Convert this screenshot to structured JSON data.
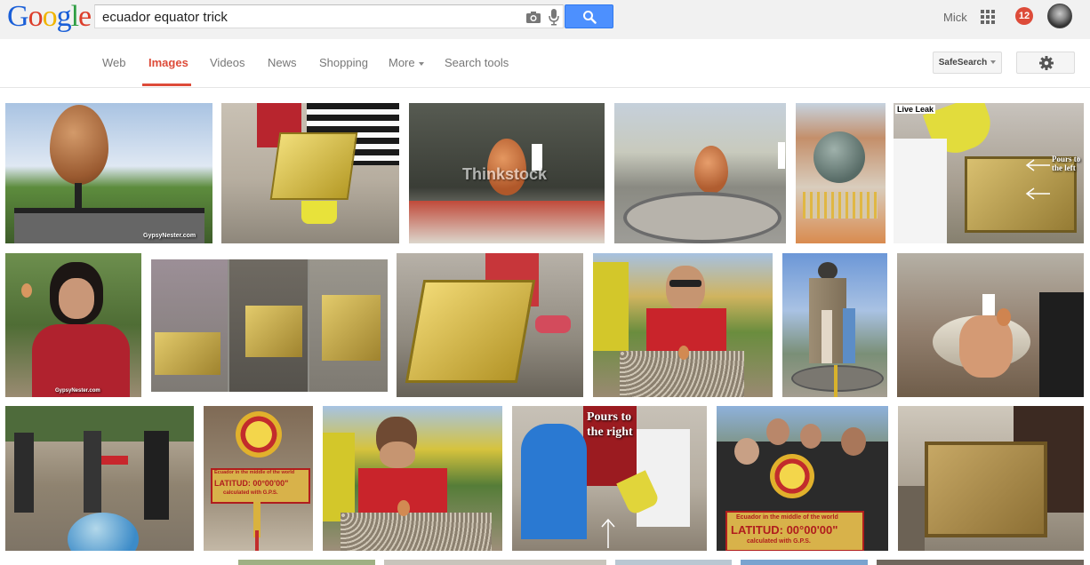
{
  "header": {
    "logo_letters": [
      {
        "ch": "G",
        "color": "#1a5fd8"
      },
      {
        "ch": "o",
        "color": "#dc3d2a"
      },
      {
        "ch": "o",
        "color": "#f0b400"
      },
      {
        "ch": "g",
        "color": "#1a5fd8"
      },
      {
        "ch": "l",
        "color": "#2f9e44"
      },
      {
        "ch": "e",
        "color": "#dc3d2a"
      }
    ],
    "search_query": "ecuador equator trick",
    "user_name": "Mick",
    "notification_count": "12"
  },
  "nav": {
    "tabs": [
      "Web",
      "Images",
      "Videos",
      "News",
      "Shopping",
      "More",
      "Search tools"
    ],
    "active_tab": "Images",
    "safesearch_label": "SafeSearch"
  },
  "overlay_texts": {
    "gypsy1": "GypsyNester.com",
    "thinkstock": "Thinkstock",
    "liveleak": "Live Leak",
    "pours_left": "Pours to the left",
    "gypsy2": "GypsyNester.com",
    "pours_right": "Pours to the right",
    "sign_line1": "Ecuador in the middle of the world",
    "sign_lat": "LATITUD: 00°00'00\"",
    "sign_line3": "calculated with G.P.S."
  },
  "colors": {
    "accent_red": "#dd4b39",
    "search_blue": "#4d90fe",
    "topbar_bg": "#f1f1f1"
  }
}
